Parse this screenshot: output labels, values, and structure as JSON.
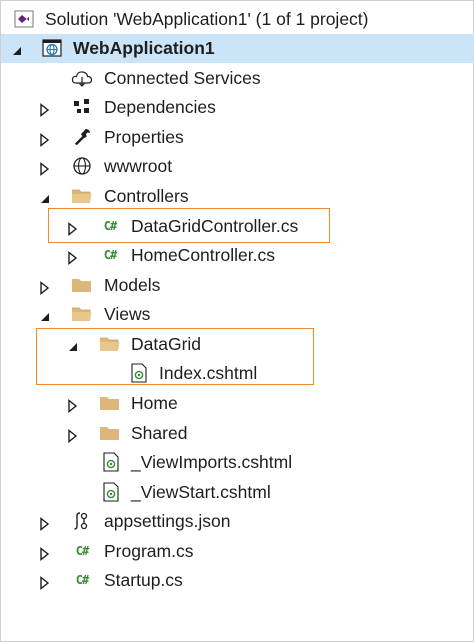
{
  "tree": {
    "solution_label": "Solution 'WebApplication1' (1 of 1 project)",
    "project_label": "WebApplication1",
    "items": {
      "connected_services": "Connected Services",
      "dependencies": "Dependencies",
      "properties": "Properties",
      "wwwroot": "wwwroot",
      "controllers": "Controllers",
      "datagrid_controller": "DataGridController.cs",
      "home_controller": "HomeController.cs",
      "models": "Models",
      "views": "Views",
      "datagrid_folder": "DataGrid",
      "index_cshtml": "Index.cshtml",
      "home_folder": "Home",
      "shared_folder": "Shared",
      "view_imports": "_ViewImports.cshtml",
      "view_start": "_ViewStart.cshtml",
      "appsettings": "appsettings.json",
      "program": "Program.cs",
      "startup": "Startup.cs"
    },
    "cs_badge": "C#"
  },
  "colors": {
    "selected_row": "#cce4f7",
    "highlight_border": "#f08a2e",
    "folder": "#dcb67a",
    "csharp": "#388a34",
    "vs_purple": "#68217a"
  }
}
